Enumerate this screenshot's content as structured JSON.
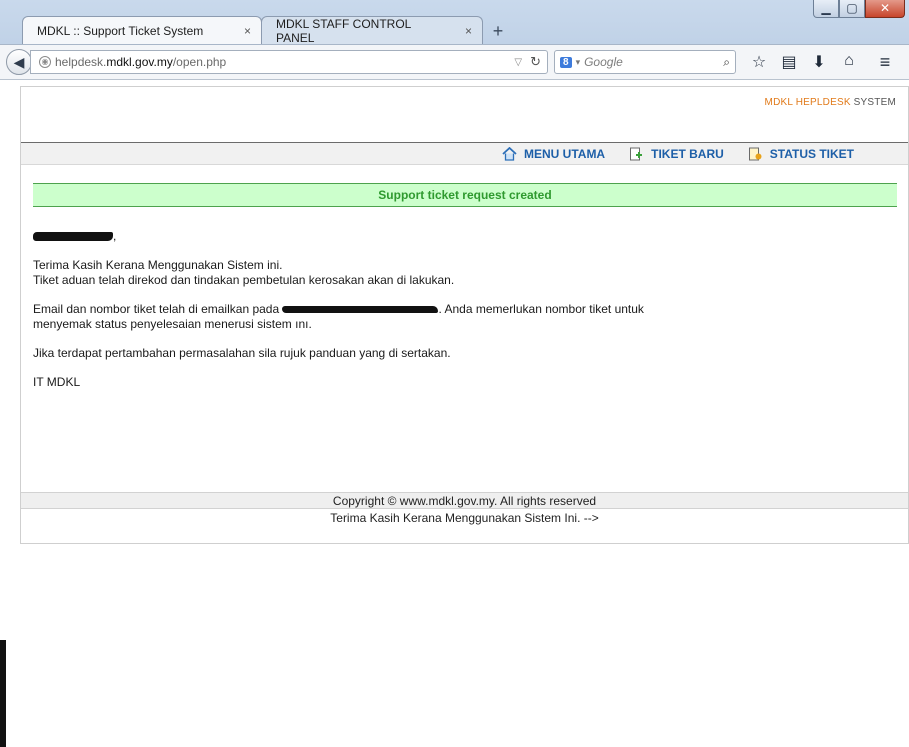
{
  "browser": {
    "tabs": [
      {
        "label": "MDKL :: Support Ticket System",
        "close": "×"
      },
      {
        "label": "MDKL STAFF CONTROL PANEL",
        "close": "×"
      }
    ],
    "new_tab": "+",
    "url": {
      "pre": "helpdesk.",
      "host": "mdkl.gov.my",
      "path": "/open.php"
    },
    "search": {
      "engine_badge": "8",
      "placeholder": "Google"
    },
    "window_controls": {
      "minimize": "▁",
      "maximize": "▢",
      "close": "✕"
    }
  },
  "header": {
    "brand_prefix": "MDKL HEPLDESK",
    "brand_suffix": " SYSTEM"
  },
  "menu": {
    "items": [
      "MENU UTAMA",
      "TIKET BARU",
      "STATUS TIKET"
    ]
  },
  "notice": "Support ticket request created",
  "content": {
    "line1": "Terima Kasih Kerana Menggunakan Sistem ini.",
    "line2": "Tiket aduan telah direkod dan tindakan pembetulan kerosakan akan di lakukan.",
    "email_pre": "Email dan nombor tiket telah di emailkan pada",
    "email_post": ". Anda memerlukan nombor tiket untuk",
    "email_line2": "menyemak status penyelesaian menerusi sistem ını.",
    "line4": "Jika terdapat pertambahan permasalahan sila rujuk panduan yang di sertakan.",
    "signature": "IT MDKL"
  },
  "footer": {
    "copyright": "Copyright © www.mdkl.gov.my. All rights reserved",
    "thanks": "Terima Kasih Kerana Menggunakan Sistem Ini. -->"
  },
  "colors": {
    "menu_link": "#1d5fa8",
    "notice_bg": "#ccffcc",
    "notice_text": "#2f9a2f",
    "brand_orange": "#e17a1a"
  }
}
